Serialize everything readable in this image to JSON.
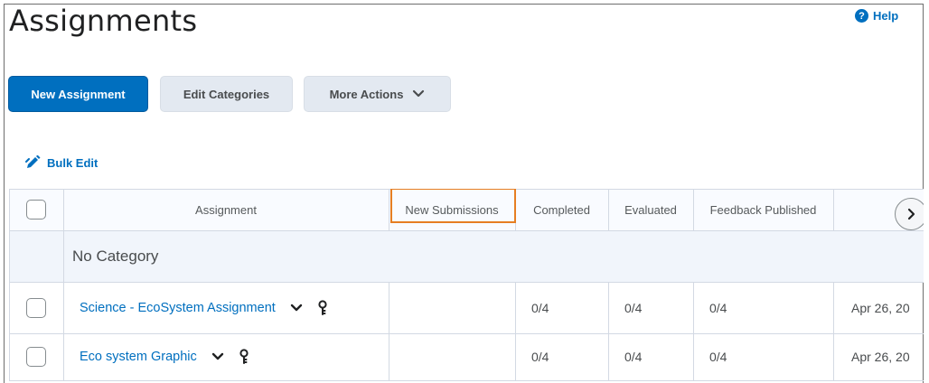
{
  "header": {
    "title": "Assignments",
    "help_label": "Help",
    "help_glyph": "?"
  },
  "toolbar": {
    "new_label": "New Assignment",
    "edit_label": "Edit Categories",
    "more_label": "More Actions"
  },
  "bulk_edit_label": "Bulk Edit",
  "table": {
    "columns": [
      "Assignment",
      "New Submissions",
      "Completed",
      "Evaluated",
      "Feedback Published"
    ],
    "category": "No Category",
    "rows": [
      {
        "name": "Science - EcoSystem Assignment",
        "new_submissions": "",
        "completed": "0/4",
        "evaluated": "0/4",
        "feedback": "0/4",
        "date": "Apr 26, 20"
      },
      {
        "name": "Eco system Graphic",
        "new_submissions": "",
        "completed": "0/4",
        "evaluated": "0/4",
        "feedback": "0/4",
        "date": "Apr 26, 20"
      }
    ]
  },
  "colors": {
    "accent": "#006fbf",
    "highlight": "#e67e22"
  }
}
